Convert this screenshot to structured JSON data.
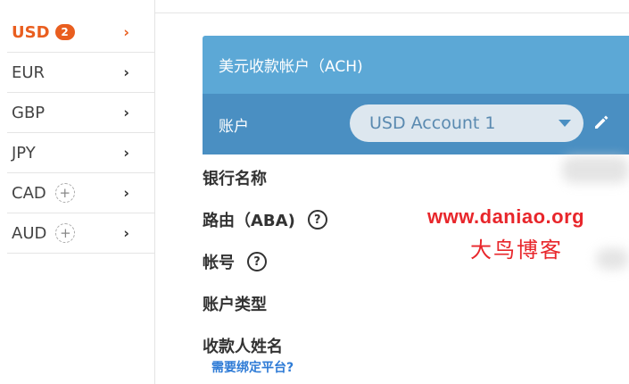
{
  "sidebar": {
    "items": [
      {
        "code": "USD",
        "badge": "2",
        "chevron": "›"
      },
      {
        "code": "EUR",
        "chevron": "›"
      },
      {
        "code": "GBP",
        "chevron": "›"
      },
      {
        "code": "JPY",
        "chevron": "›"
      },
      {
        "code": "CAD",
        "plus": "+",
        "chevron": "›"
      },
      {
        "code": "AUD",
        "plus": "+",
        "chevron": "›"
      }
    ]
  },
  "card": {
    "title": "美元收款帐户（ACH)",
    "account_label": "账户",
    "account_selected": "USD Account 1",
    "fields": {
      "bank_name": "银行名称",
      "routing": "路由（ABA)",
      "account_number": "帐号",
      "account_type": "账户类型",
      "payee_name": "收款人姓名"
    },
    "help_symbol": "?",
    "bind_platform_link": "需要绑定平台?"
  },
  "watermark": {
    "url": "www.daniao.org",
    "name": "大鸟博客"
  },
  "colors": {
    "accent": "#e95e1f",
    "header": "#5ca8d6",
    "account_bar": "#4a8fc2",
    "link": "#2e7bd6",
    "watermark": "#e8262b"
  }
}
